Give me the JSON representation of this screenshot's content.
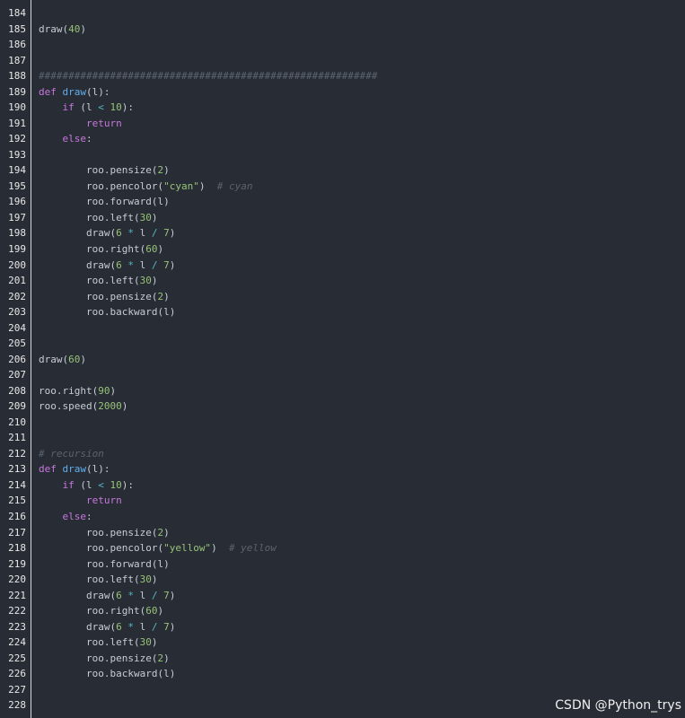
{
  "editor": {
    "lines": [
      {
        "num": "184",
        "tokens": []
      },
      {
        "num": "185",
        "tokens": [
          {
            "t": "plain",
            "v": "draw("
          },
          {
            "t": "number",
            "v": "40"
          },
          {
            "t": "plain",
            "v": ")"
          }
        ]
      },
      {
        "num": "186",
        "tokens": []
      },
      {
        "num": "187",
        "tokens": []
      },
      {
        "num": "188",
        "tokens": [
          {
            "t": "comment",
            "v": "#########################################################"
          }
        ]
      },
      {
        "num": "189",
        "tokens": [
          {
            "t": "keyword",
            "v": "def "
          },
          {
            "t": "function",
            "v": "draw"
          },
          {
            "t": "plain",
            "v": "(l):"
          }
        ]
      },
      {
        "num": "190",
        "tokens": [
          {
            "t": "plain",
            "v": "    "
          },
          {
            "t": "keyword",
            "v": "if"
          },
          {
            "t": "plain",
            "v": " (l "
          },
          {
            "t": "operator",
            "v": "<"
          },
          {
            "t": "plain",
            "v": " "
          },
          {
            "t": "number",
            "v": "10"
          },
          {
            "t": "plain",
            "v": "):"
          }
        ]
      },
      {
        "num": "191",
        "tokens": [
          {
            "t": "plain",
            "v": "        "
          },
          {
            "t": "keyword",
            "v": "return"
          }
        ]
      },
      {
        "num": "192",
        "tokens": [
          {
            "t": "plain",
            "v": "    "
          },
          {
            "t": "keyword",
            "v": "else"
          },
          {
            "t": "plain",
            "v": ":"
          }
        ]
      },
      {
        "num": "193",
        "tokens": []
      },
      {
        "num": "194",
        "tokens": [
          {
            "t": "plain",
            "v": "        roo.pensize("
          },
          {
            "t": "number",
            "v": "2"
          },
          {
            "t": "plain",
            "v": ")"
          }
        ]
      },
      {
        "num": "195",
        "tokens": [
          {
            "t": "plain",
            "v": "        roo.pencolor("
          },
          {
            "t": "string",
            "v": "\"cyan\""
          },
          {
            "t": "plain",
            "v": ")  "
          },
          {
            "t": "comment",
            "v": "# cyan"
          }
        ]
      },
      {
        "num": "196",
        "tokens": [
          {
            "t": "plain",
            "v": "        roo.forward(l)"
          }
        ]
      },
      {
        "num": "197",
        "tokens": [
          {
            "t": "plain",
            "v": "        roo.left("
          },
          {
            "t": "number",
            "v": "30"
          },
          {
            "t": "plain",
            "v": ")"
          }
        ]
      },
      {
        "num": "198",
        "tokens": [
          {
            "t": "plain",
            "v": "        draw("
          },
          {
            "t": "number",
            "v": "6"
          },
          {
            "t": "plain",
            "v": " "
          },
          {
            "t": "operator",
            "v": "*"
          },
          {
            "t": "plain",
            "v": " l "
          },
          {
            "t": "operator",
            "v": "/"
          },
          {
            "t": "plain",
            "v": " "
          },
          {
            "t": "number",
            "v": "7"
          },
          {
            "t": "plain",
            "v": ")"
          }
        ]
      },
      {
        "num": "199",
        "tokens": [
          {
            "t": "plain",
            "v": "        roo.right("
          },
          {
            "t": "number",
            "v": "60"
          },
          {
            "t": "plain",
            "v": ")"
          }
        ]
      },
      {
        "num": "200",
        "tokens": [
          {
            "t": "plain",
            "v": "        draw("
          },
          {
            "t": "number",
            "v": "6"
          },
          {
            "t": "plain",
            "v": " "
          },
          {
            "t": "operator",
            "v": "*"
          },
          {
            "t": "plain",
            "v": " l "
          },
          {
            "t": "operator",
            "v": "/"
          },
          {
            "t": "plain",
            "v": " "
          },
          {
            "t": "number",
            "v": "7"
          },
          {
            "t": "plain",
            "v": ")"
          }
        ]
      },
      {
        "num": "201",
        "tokens": [
          {
            "t": "plain",
            "v": "        roo.left("
          },
          {
            "t": "number",
            "v": "30"
          },
          {
            "t": "plain",
            "v": ")"
          }
        ]
      },
      {
        "num": "202",
        "tokens": [
          {
            "t": "plain",
            "v": "        roo.pensize("
          },
          {
            "t": "number",
            "v": "2"
          },
          {
            "t": "plain",
            "v": ")"
          }
        ]
      },
      {
        "num": "203",
        "tokens": [
          {
            "t": "plain",
            "v": "        roo.backward(l)"
          }
        ]
      },
      {
        "num": "204",
        "tokens": []
      },
      {
        "num": "205",
        "tokens": []
      },
      {
        "num": "206",
        "tokens": [
          {
            "t": "plain",
            "v": "draw("
          },
          {
            "t": "number",
            "v": "60"
          },
          {
            "t": "plain",
            "v": ")"
          }
        ]
      },
      {
        "num": "207",
        "tokens": []
      },
      {
        "num": "208",
        "tokens": [
          {
            "t": "plain",
            "v": "roo.right("
          },
          {
            "t": "number",
            "v": "90"
          },
          {
            "t": "plain",
            "v": ")"
          }
        ]
      },
      {
        "num": "209",
        "tokens": [
          {
            "t": "plain",
            "v": "roo.speed("
          },
          {
            "t": "number",
            "v": "2000"
          },
          {
            "t": "plain",
            "v": ")"
          }
        ]
      },
      {
        "num": "210",
        "tokens": []
      },
      {
        "num": "211",
        "tokens": []
      },
      {
        "num": "212",
        "tokens": [
          {
            "t": "comment",
            "v": "# recursion"
          }
        ]
      },
      {
        "num": "213",
        "tokens": [
          {
            "t": "keyword",
            "v": "def "
          },
          {
            "t": "function",
            "v": "draw"
          },
          {
            "t": "plain",
            "v": "(l):"
          }
        ]
      },
      {
        "num": "214",
        "tokens": [
          {
            "t": "plain",
            "v": "    "
          },
          {
            "t": "keyword",
            "v": "if"
          },
          {
            "t": "plain",
            "v": " (l "
          },
          {
            "t": "operator",
            "v": "<"
          },
          {
            "t": "plain",
            "v": " "
          },
          {
            "t": "number",
            "v": "10"
          },
          {
            "t": "plain",
            "v": "):"
          }
        ]
      },
      {
        "num": "215",
        "tokens": [
          {
            "t": "plain",
            "v": "        "
          },
          {
            "t": "keyword",
            "v": "return"
          }
        ]
      },
      {
        "num": "216",
        "tokens": [
          {
            "t": "plain",
            "v": "    "
          },
          {
            "t": "keyword",
            "v": "else"
          },
          {
            "t": "plain",
            "v": ":"
          }
        ]
      },
      {
        "num": "217",
        "tokens": [
          {
            "t": "plain",
            "v": "        roo.pensize("
          },
          {
            "t": "number",
            "v": "2"
          },
          {
            "t": "plain",
            "v": ")"
          }
        ]
      },
      {
        "num": "218",
        "tokens": [
          {
            "t": "plain",
            "v": "        roo.pencolor("
          },
          {
            "t": "string",
            "v": "\"yellow\""
          },
          {
            "t": "plain",
            "v": ")  "
          },
          {
            "t": "comment",
            "v": "# yellow"
          }
        ]
      },
      {
        "num": "219",
        "tokens": [
          {
            "t": "plain",
            "v": "        roo.forward(l)"
          }
        ]
      },
      {
        "num": "220",
        "tokens": [
          {
            "t": "plain",
            "v": "        roo.left("
          },
          {
            "t": "number",
            "v": "30"
          },
          {
            "t": "plain",
            "v": ")"
          }
        ]
      },
      {
        "num": "221",
        "tokens": [
          {
            "t": "plain",
            "v": "        draw("
          },
          {
            "t": "number",
            "v": "6"
          },
          {
            "t": "plain",
            "v": " "
          },
          {
            "t": "operator",
            "v": "*"
          },
          {
            "t": "plain",
            "v": " l "
          },
          {
            "t": "operator",
            "v": "/"
          },
          {
            "t": "plain",
            "v": " "
          },
          {
            "t": "number",
            "v": "7"
          },
          {
            "t": "plain",
            "v": ")"
          }
        ]
      },
      {
        "num": "222",
        "tokens": [
          {
            "t": "plain",
            "v": "        roo.right("
          },
          {
            "t": "number",
            "v": "60"
          },
          {
            "t": "plain",
            "v": ")"
          }
        ]
      },
      {
        "num": "223",
        "tokens": [
          {
            "t": "plain",
            "v": "        draw("
          },
          {
            "t": "number",
            "v": "6"
          },
          {
            "t": "plain",
            "v": " "
          },
          {
            "t": "operator",
            "v": "*"
          },
          {
            "t": "plain",
            "v": " l "
          },
          {
            "t": "operator",
            "v": "/"
          },
          {
            "t": "plain",
            "v": " "
          },
          {
            "t": "number",
            "v": "7"
          },
          {
            "t": "plain",
            "v": ")"
          }
        ]
      },
      {
        "num": "224",
        "tokens": [
          {
            "t": "plain",
            "v": "        roo.left("
          },
          {
            "t": "number",
            "v": "30"
          },
          {
            "t": "plain",
            "v": ")"
          }
        ]
      },
      {
        "num": "225",
        "tokens": [
          {
            "t": "plain",
            "v": "        roo.pensize("
          },
          {
            "t": "number",
            "v": "2"
          },
          {
            "t": "plain",
            "v": ")"
          }
        ]
      },
      {
        "num": "226",
        "tokens": [
          {
            "t": "plain",
            "v": "        roo.backward(l)"
          }
        ]
      },
      {
        "num": "227",
        "tokens": []
      },
      {
        "num": "228",
        "tokens": []
      }
    ]
  },
  "watermark": {
    "text": "CSDN @Python_trys"
  },
  "colors": {
    "background": "#282c34",
    "keyword": "#c678dd",
    "function": "#61afef",
    "number": "#98c379",
    "string": "#98c379",
    "comment": "#5c6370",
    "plain": "#c8ccd4",
    "line_number": "#e8e8e8"
  }
}
